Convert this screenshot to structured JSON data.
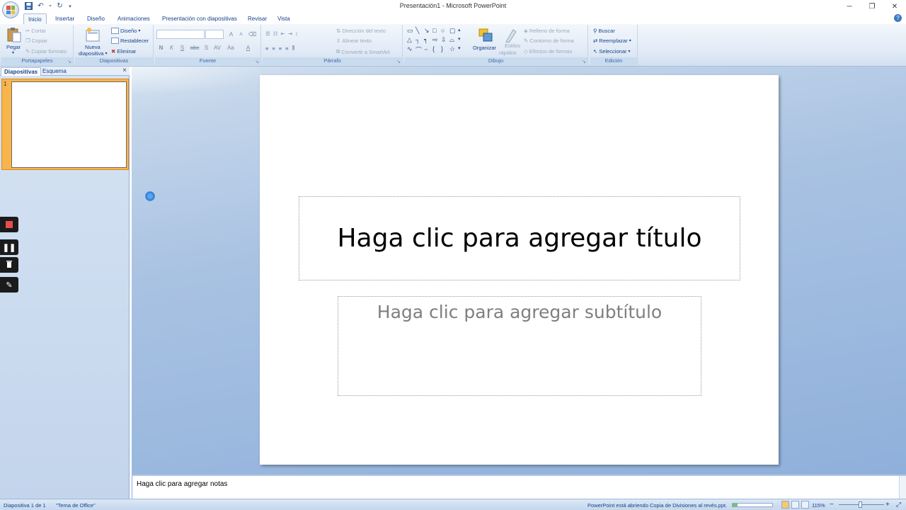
{
  "window": {
    "title": "Presentación1 - Microsoft PowerPoint"
  },
  "tabs": [
    "Inicio",
    "Insertar",
    "Diseño",
    "Animaciones",
    "Presentación con diapositivas",
    "Revisar",
    "Vista"
  ],
  "ribbon": {
    "portapapeles": {
      "label": "Portapapeles",
      "paste": "Pegar",
      "cut": "Cortar",
      "copy": "Copiar",
      "format": "Copiar formato"
    },
    "diapositivas": {
      "label": "Diapositivas",
      "new_line1": "Nueva",
      "new_line2": "diapositiva",
      "design": "Diseño",
      "reset": "Restablecer",
      "delete": "Eliminar"
    },
    "fuente": {
      "label": "Fuente",
      "bold": "N",
      "italic": "K",
      "underline": "S",
      "strike": "abc",
      "shadow": "S",
      "spacing": "AV",
      "case": "Aa",
      "color": "A",
      "grow": "A",
      "shrink": "A"
    },
    "parrafo": {
      "label": "Párrafo",
      "direction": "Dirección del texto",
      "align": "Alinear texto",
      "smartart": "Convertir a SmartArt"
    },
    "dibujo": {
      "label": "Dibujo",
      "arrange": "Organizar",
      "styles_line1": "Estilos",
      "styles_line2": "rápidos",
      "fill": "Relleno de forma",
      "outline": "Contorno de forma",
      "effects": "Efectos de formas"
    },
    "edicion": {
      "label": "Edición",
      "find": "Buscar",
      "replace": "Reemplazar",
      "select": "Seleccionar"
    }
  },
  "panel": {
    "tab_slides": "Diapositivas",
    "tab_outline": "Esquema",
    "close": "×",
    "slide_number": "1"
  },
  "slide": {
    "title_placeholder": "Haga clic para agregar título",
    "subtitle_placeholder": "Haga clic para agregar subtítulo"
  },
  "notes": {
    "placeholder": "Haga clic para agregar notas"
  },
  "status": {
    "slide_info": "Diapositiva 1 de 1",
    "theme": "\"Tema de Office\"",
    "message": "PowerPoint está abriendo Copia de Divisiones al revés.ppt.",
    "progress": 0.12,
    "zoom": "115%",
    "zoom_minus": "−",
    "zoom_plus": "+"
  },
  "colors": {
    "accent": "#15428b",
    "ribbon": "#dfe9f5",
    "selected_thumb": "#f7b54b",
    "record": "#e84c4c"
  }
}
